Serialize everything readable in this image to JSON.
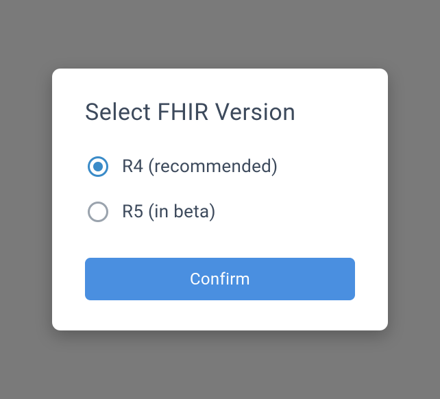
{
  "modal": {
    "title": "Select FHIR Version",
    "options": [
      {
        "label": "R4 (recommended)",
        "selected": true
      },
      {
        "label": "R5 (in beta)",
        "selected": false
      }
    ],
    "confirm_label": "Confirm"
  }
}
